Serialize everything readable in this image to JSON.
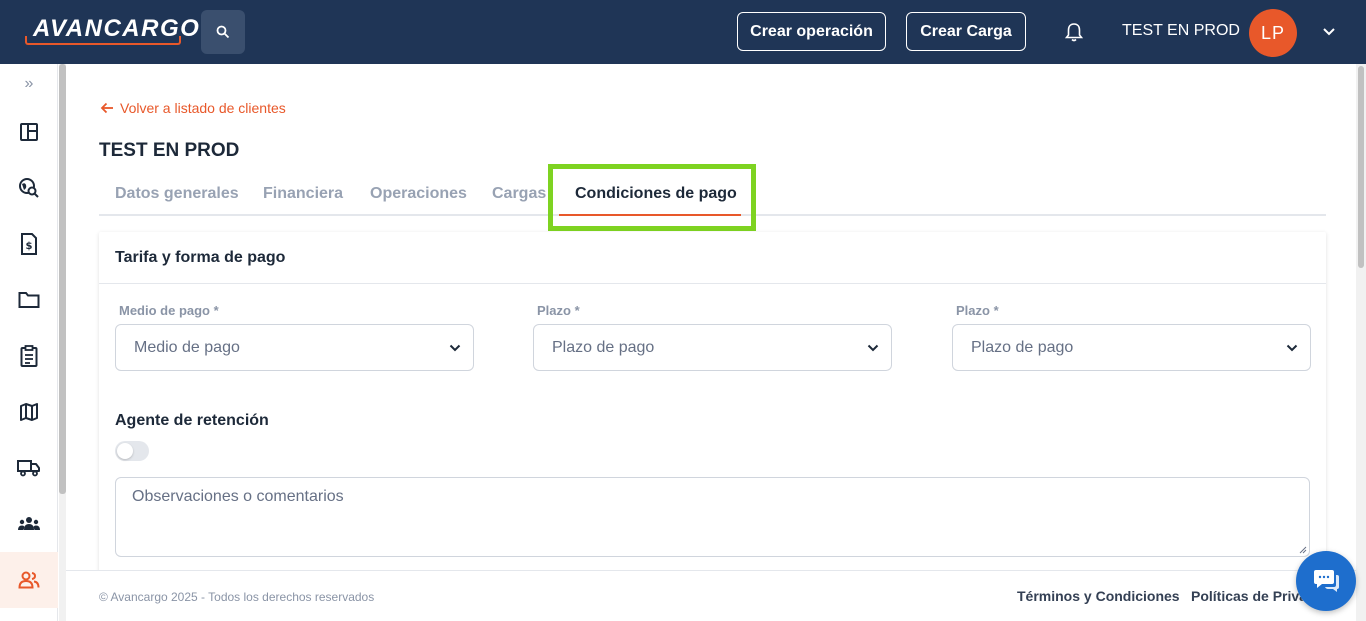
{
  "header": {
    "logo_text": "AVANCARGO",
    "create_operation_label": "Crear operación",
    "create_cargo_label": "Crear Carga",
    "username": "TEST EN PROD",
    "avatar_initials": "LP"
  },
  "sidebar": {
    "expand_label": "»",
    "items": [
      {
        "icon": "dashboard-icon"
      },
      {
        "icon": "globe-search-icon"
      },
      {
        "icon": "invoice-icon"
      },
      {
        "icon": "folder-icon"
      },
      {
        "icon": "clipboard-icon"
      },
      {
        "icon": "map-icon"
      },
      {
        "icon": "truck-icon"
      },
      {
        "icon": "group-icon"
      },
      {
        "icon": "clients-icon",
        "active": true
      }
    ]
  },
  "page": {
    "back_label": "Volver a listado de clientes",
    "title": "TEST EN PROD",
    "tabs": [
      {
        "label": "Datos generales"
      },
      {
        "label": "Financiera"
      },
      {
        "label": "Operaciones"
      },
      {
        "label": "Cargas"
      },
      {
        "label": "Condiciones de pago",
        "active": true
      }
    ]
  },
  "card": {
    "title": "Tarifa y forma de pago",
    "fields": [
      {
        "label": "Medio de pago *",
        "placeholder": "Medio de pago"
      },
      {
        "label": "Plazo *",
        "placeholder": "Plazo de pago"
      },
      {
        "label": "Plazo *",
        "placeholder": "Plazo de pago"
      }
    ],
    "agente_label": "Agente de retención",
    "agente_enabled": false,
    "comments_placeholder": "Observaciones o comentarios"
  },
  "footer": {
    "copyright": "© Avancargo 2025 - Todos los derechos reservados",
    "terms": "Términos y Condiciones",
    "privacy": "Políticas de Priva"
  },
  "colors": {
    "brand_navy": "#1f3556",
    "accent_orange": "#e8582a",
    "highlight_green": "#7ed321",
    "chat_blue": "#1e6ecd"
  }
}
